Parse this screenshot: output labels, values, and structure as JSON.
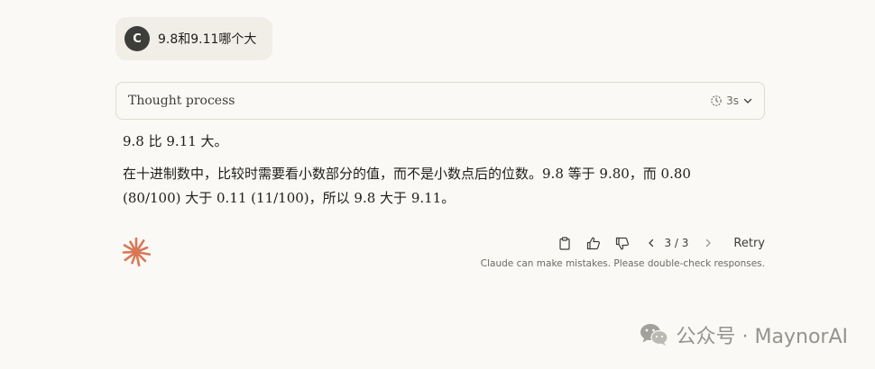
{
  "user_message": {
    "avatar_initial": "C",
    "text": "9.8和9.11哪个大"
  },
  "thought": {
    "label": "Thought process",
    "duration": "3s",
    "icon": "timer-icon"
  },
  "answer": {
    "paragraph1": "9.8 比 9.11 大。",
    "paragraph2": "在十进制数中，比较时需要看小数部分的值，而不是小数点后的位数。9.8 等于 9.80，而 0.80 (80/100) 大于 0.11 (11/100)，所以 9.8 大于 9.11。"
  },
  "actions": {
    "copy_icon": "clipboard-icon",
    "like_icon": "thumbs-up-icon",
    "dislike_icon": "thumbs-down-icon",
    "pager": "3 / 3",
    "retry_label": "Retry"
  },
  "disclaimer": "Claude can make mistakes. Please double-check responses.",
  "watermark": {
    "text": "公众号 · MaynorAI",
    "icon": "wechat-icon"
  },
  "colors": {
    "background": "#faf9f5",
    "user_bubble": "#f0eee6",
    "avatar": "#3d3d3a",
    "brand": "#d97757",
    "text": "#1f1e1d",
    "muted": "#6b6a65"
  }
}
